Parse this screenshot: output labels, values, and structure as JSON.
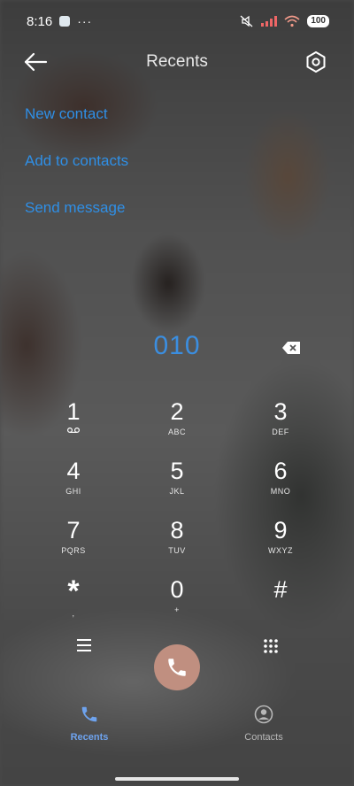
{
  "status_bar": {
    "time": "8:16",
    "more": "···",
    "battery": "100"
  },
  "header": {
    "title": "Recents"
  },
  "actions": [
    {
      "label": "New contact"
    },
    {
      "label": "Add to contacts"
    },
    {
      "label": "Send message"
    }
  ],
  "dialer": {
    "number": "010"
  },
  "keypad": [
    {
      "digit": "1",
      "letters": ""
    },
    {
      "digit": "2",
      "letters": "ABC"
    },
    {
      "digit": "3",
      "letters": "DEF"
    },
    {
      "digit": "4",
      "letters": "GHI"
    },
    {
      "digit": "5",
      "letters": "JKL"
    },
    {
      "digit": "6",
      "letters": "MNO"
    },
    {
      "digit": "7",
      "letters": "PQRS"
    },
    {
      "digit": "8",
      "letters": "TUV"
    },
    {
      "digit": "9",
      "letters": "WXYZ"
    },
    {
      "digit": "*",
      "letters": ","
    },
    {
      "digit": "0",
      "letters": "+"
    },
    {
      "digit": "#",
      "letters": ""
    }
  ],
  "nav": {
    "recents_label": "Recents",
    "contacts_label": "Contacts"
  },
  "colors": {
    "accent": "#2f8fe6",
    "call_button": "#c08f80",
    "active_tab": "#6ea3ee",
    "inactive_tab": "#b8b8b8"
  },
  "icons": {
    "back": "arrow-left-icon",
    "settings": "settings-icon",
    "backspace": "backspace-icon",
    "voicemail": "voicemail-icon",
    "menu": "menu-icon",
    "dialpad": "dialpad-icon",
    "call": "phone-icon",
    "contacts": "person-icon"
  }
}
